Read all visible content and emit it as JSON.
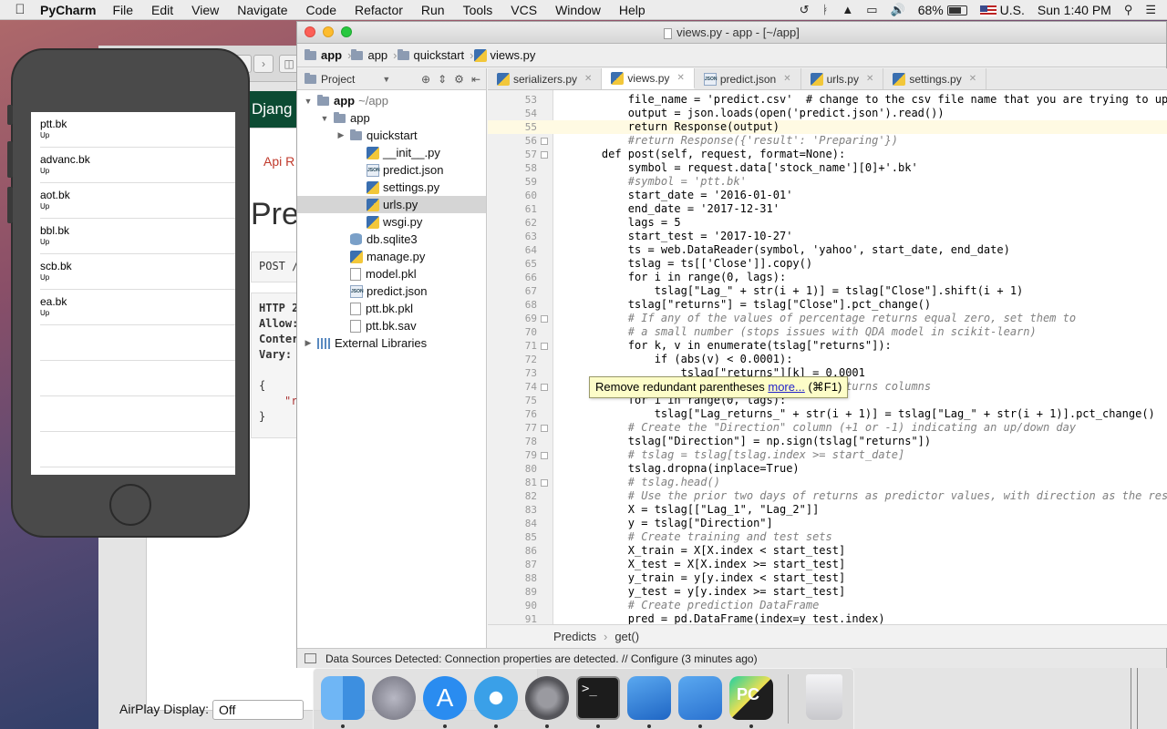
{
  "menubar": {
    "app_name": "PyCharm",
    "menus": [
      "File",
      "Edit",
      "View",
      "Navigate",
      "Code",
      "Refactor",
      "Run",
      "Tools",
      "VCS",
      "Window",
      "Help"
    ],
    "battery": "68%",
    "input_source": "U.S.",
    "clock": "Sun 1:40 PM"
  },
  "browser": {
    "brand": "Djang",
    "api_link": "Api R",
    "page_title": "Pre",
    "post_line": "POST /",
    "response_lines": [
      "HTTP 2",
      "Allow:",
      "Conter",
      "Vary:"
    ],
    "brace_open": "{",
    "brace_item": "\"r",
    "brace_close": "}",
    "airplay_label": "AirPlay Display:",
    "airplay_value": "Off"
  },
  "phone": {
    "rows": [
      {
        "name": "ptt.bk",
        "sub": "Up"
      },
      {
        "name": "advanc.bk",
        "sub": "Up"
      },
      {
        "name": "aot.bk",
        "sub": "Up"
      },
      {
        "name": "bbl.bk",
        "sub": "Up"
      },
      {
        "name": "scb.bk",
        "sub": "Up"
      },
      {
        "name": "ea.bk",
        "sub": "Up"
      }
    ]
  },
  "ide": {
    "window_title": "views.py - app - [~/app]",
    "nav": [
      "app",
      "app",
      "quickstart",
      "views.py"
    ],
    "project_label": "Project",
    "tree": [
      {
        "label": "app",
        "suffix": "~/app",
        "indent": 0,
        "arrow": "▼",
        "icon": "folder",
        "bold": true
      },
      {
        "label": "app",
        "suffix": "",
        "indent": 1,
        "arrow": "▼",
        "icon": "folder"
      },
      {
        "label": "quickstart",
        "suffix": "",
        "indent": 2,
        "arrow": "▶",
        "icon": "folder"
      },
      {
        "label": "__init__.py",
        "suffix": "",
        "indent": 3,
        "arrow": "",
        "icon": "py"
      },
      {
        "label": "predict.json",
        "suffix": "",
        "indent": 3,
        "arrow": "",
        "icon": "json"
      },
      {
        "label": "settings.py",
        "suffix": "",
        "indent": 3,
        "arrow": "",
        "icon": "py"
      },
      {
        "label": "urls.py",
        "suffix": "",
        "indent": 3,
        "arrow": "",
        "icon": "py",
        "selected": true
      },
      {
        "label": "wsgi.py",
        "suffix": "",
        "indent": 3,
        "arrow": "",
        "icon": "py"
      },
      {
        "label": "db.sqlite3",
        "suffix": "",
        "indent": 2,
        "arrow": "",
        "icon": "db"
      },
      {
        "label": "manage.py",
        "suffix": "",
        "indent": 2,
        "arrow": "",
        "icon": "py"
      },
      {
        "label": "model.pkl",
        "suffix": "",
        "indent": 2,
        "arrow": "",
        "icon": "file"
      },
      {
        "label": "predict.json",
        "suffix": "",
        "indent": 2,
        "arrow": "",
        "icon": "json"
      },
      {
        "label": "ptt.bk.pkl",
        "suffix": "",
        "indent": 2,
        "arrow": "",
        "icon": "file"
      },
      {
        "label": "ptt.bk.sav",
        "suffix": "",
        "indent": 2,
        "arrow": "",
        "icon": "file"
      },
      {
        "label": "External Libraries",
        "suffix": "",
        "indent": 0,
        "arrow": "▶",
        "icon": "lib"
      }
    ],
    "tabs": [
      {
        "label": "serializers.py",
        "icon": "py"
      },
      {
        "label": "views.py",
        "icon": "py",
        "active": true
      },
      {
        "label": "predict.json",
        "icon": "json"
      },
      {
        "label": "urls.py",
        "icon": "py"
      },
      {
        "label": "settings.py",
        "icon": "py"
      }
    ],
    "code": [
      {
        "n": "53",
        "t": "        file_name = 'predict.csv'  # change to the csv file name that you are trying to upload"
      },
      {
        "n": "54",
        "t": "        output = json.loads(open('predict.json').read())"
      },
      {
        "n": "55",
        "t": "        return Response(output)",
        "hl": true
      },
      {
        "n": "56",
        "t": "        #return Response({'result': 'Preparing'})"
      },
      {
        "n": "57",
        "t": "    def post(self, request, format=None):"
      },
      {
        "n": "58",
        "t": "        symbol = request.data['stock_name'][0]+'.bk'"
      },
      {
        "n": "59",
        "t": "        #symbol = 'ptt.bk'"
      },
      {
        "n": "60",
        "t": "        start_date = '2016-01-01'"
      },
      {
        "n": "61",
        "t": "        end_date = '2017-12-31'"
      },
      {
        "n": "62",
        "t": "        lags = 5"
      },
      {
        "n": "63",
        "t": "        start_test = '2017-10-27'"
      },
      {
        "n": "64",
        "t": "        ts = web.DataReader(symbol, 'yahoo', start_date, end_date)"
      },
      {
        "n": "65",
        "t": "        tslag = ts[['Close']].copy()"
      },
      {
        "n": "66",
        "t": "        for i in range(0, lags):"
      },
      {
        "n": "67",
        "t": "            tslag[\"Lag_\" + str(i + 1)] = tslag[\"Close\"].shift(i + 1)"
      },
      {
        "n": "68",
        "t": "        tslag[\"returns\"] = tslag[\"Close\"].pct_change()"
      },
      {
        "n": "69",
        "t": "        # If any of the values of percentage returns equal zero, set them to"
      },
      {
        "n": "70",
        "t": "        # a small number (stops issues with QDA model in scikit-learn)"
      },
      {
        "n": "71",
        "t": "        for k, v in enumerate(tslag[\"returns\"]):"
      },
      {
        "n": "72",
        "t": "            if (abs(v) < 0.0001):"
      },
      {
        "n": "73",
        "t": "                tslag[\"returns\"][k] = 0.0001"
      },
      {
        "n": "74",
        "t": "        # Create the lagged percentage returns columns"
      },
      {
        "n": "75",
        "t": "        for i in range(0, lags):"
      },
      {
        "n": "76",
        "t": "            tslag[\"Lag_returns_\" + str(i + 1)] = tslag[\"Lag_\" + str(i + 1)].pct_change()"
      },
      {
        "n": "77",
        "t": "        # Create the \"Direction\" column (+1 or -1) indicating an up/down day"
      },
      {
        "n": "78",
        "t": "        tslag[\"Direction\"] = np.sign(tslag[\"returns\"])"
      },
      {
        "n": "79",
        "t": "        # tslag = tslag[tslag.index >= start_date]"
      },
      {
        "n": "80",
        "t": "        tslag.dropna(inplace=True)"
      },
      {
        "n": "81",
        "t": "        # tslag.head()"
      },
      {
        "n": "82",
        "t": "        # Use the prior two days of returns as predictor values, with direction as the response"
      },
      {
        "n": "83",
        "t": "        X = tslag[[\"Lag_1\", \"Lag_2\"]]"
      },
      {
        "n": "84",
        "t": "        y = tslag[\"Direction\"]"
      },
      {
        "n": "85",
        "t": "        # Create training and test sets"
      },
      {
        "n": "86",
        "t": "        X_train = X[X.index < start_test]"
      },
      {
        "n": "87",
        "t": "        X_test = X[X.index >= start_test]"
      },
      {
        "n": "88",
        "t": "        y_train = y[y.index < start_test]"
      },
      {
        "n": "89",
        "t": "        y_test = y[y.index >= start_test]"
      },
      {
        "n": "90",
        "t": "        # Create prediction DataFrame"
      },
      {
        "n": "91",
        "t": "        pred = pd.DataFrame(index=y_test.index)"
      }
    ],
    "tooltip": {
      "text": "Remove redundant parentheses",
      "link": "more...",
      "shortcut": "(⌘F1)"
    },
    "breadcrumb": [
      "Predicts",
      "get()"
    ],
    "status": "Data Sources Detected: Connection properties are detected. // Configure (3 minutes ago)"
  },
  "dock": {
    "apps": [
      "finder-icon",
      "launchpad-icon",
      "app-store-icon",
      "safari-icon",
      "system-preferences-icon",
      "terminal-icon",
      "xcode-icon",
      "simulator-icon",
      "pycharm-icon",
      "trash-icon"
    ],
    "colors": {
      "finder": "#3d8fe0",
      "launchpad": "#8a8a96",
      "appstore": "#2a8cf0",
      "safari": "#3aa0e8",
      "sysprefs": "#6a6a70",
      "terminal": "#1c1c1c",
      "xcode": "#2a7ad6",
      "simulator": "#3c82e0",
      "pycharm": "#1e1e1e",
      "trash": "#e8e8ea"
    }
  }
}
